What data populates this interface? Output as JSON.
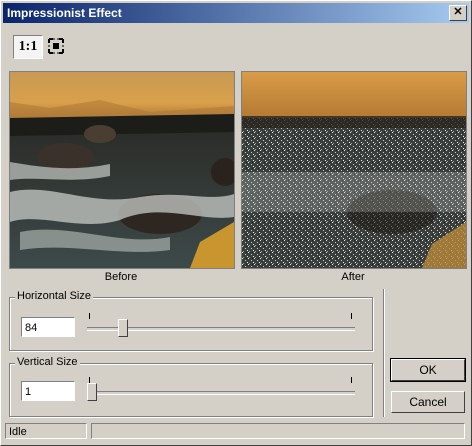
{
  "window": {
    "title": "Impressionist Effect",
    "close_glyph": "✕"
  },
  "toolbar": {
    "actual_size_label": "1:1",
    "fit_icon": "fit-to-window-icon"
  },
  "preview": {
    "before_label": "Before",
    "after_label": "After"
  },
  "horizontal": {
    "label": "Horizontal Size",
    "value": "84",
    "slider_fraction": 0.12
  },
  "vertical": {
    "label": "Vertical Size",
    "value": "1",
    "slider_fraction": 0.0
  },
  "buttons": {
    "ok": "OK",
    "cancel": "Cancel"
  },
  "status": {
    "text": "Idle"
  },
  "colors": {
    "title_start": "#0a246a",
    "title_end": "#a6caf0",
    "face": "#d4d0c8"
  }
}
